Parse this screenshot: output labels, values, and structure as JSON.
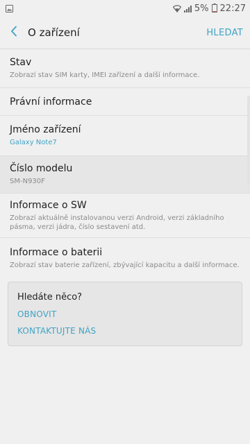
{
  "status_bar": {
    "battery_percent": "5%",
    "time": "22:27"
  },
  "app_bar": {
    "title": "O zařízení",
    "search_label": "HLEDAT"
  },
  "items": [
    {
      "title": "Stav",
      "subtitle": "Zobrazí stav SIM karty, IMEI zařízení a další informace."
    },
    {
      "title": "Právní informace",
      "subtitle": ""
    },
    {
      "title": "Jméno zařízení",
      "subtitle": "Galaxy Note7"
    },
    {
      "title": "Číslo modelu",
      "subtitle": "SM-N930F"
    },
    {
      "title": "Informace o SW",
      "subtitle": "Zobrazí aktuálně instalovanou verzi Android, verzi základního pásma, verzi jádra, číslo sestavení atd."
    },
    {
      "title": "Informace o baterii",
      "subtitle": "Zobrazí stav baterie zařízení, zbývající kapacitu a další informace."
    }
  ],
  "help_card": {
    "title": "Hledáte něco?",
    "link_refresh": "OBNOVIT",
    "link_contact": "KONTAKTUJTE NÁS"
  },
  "colors": {
    "accent": "#3fa3c4",
    "background": "#f0f0f0"
  }
}
